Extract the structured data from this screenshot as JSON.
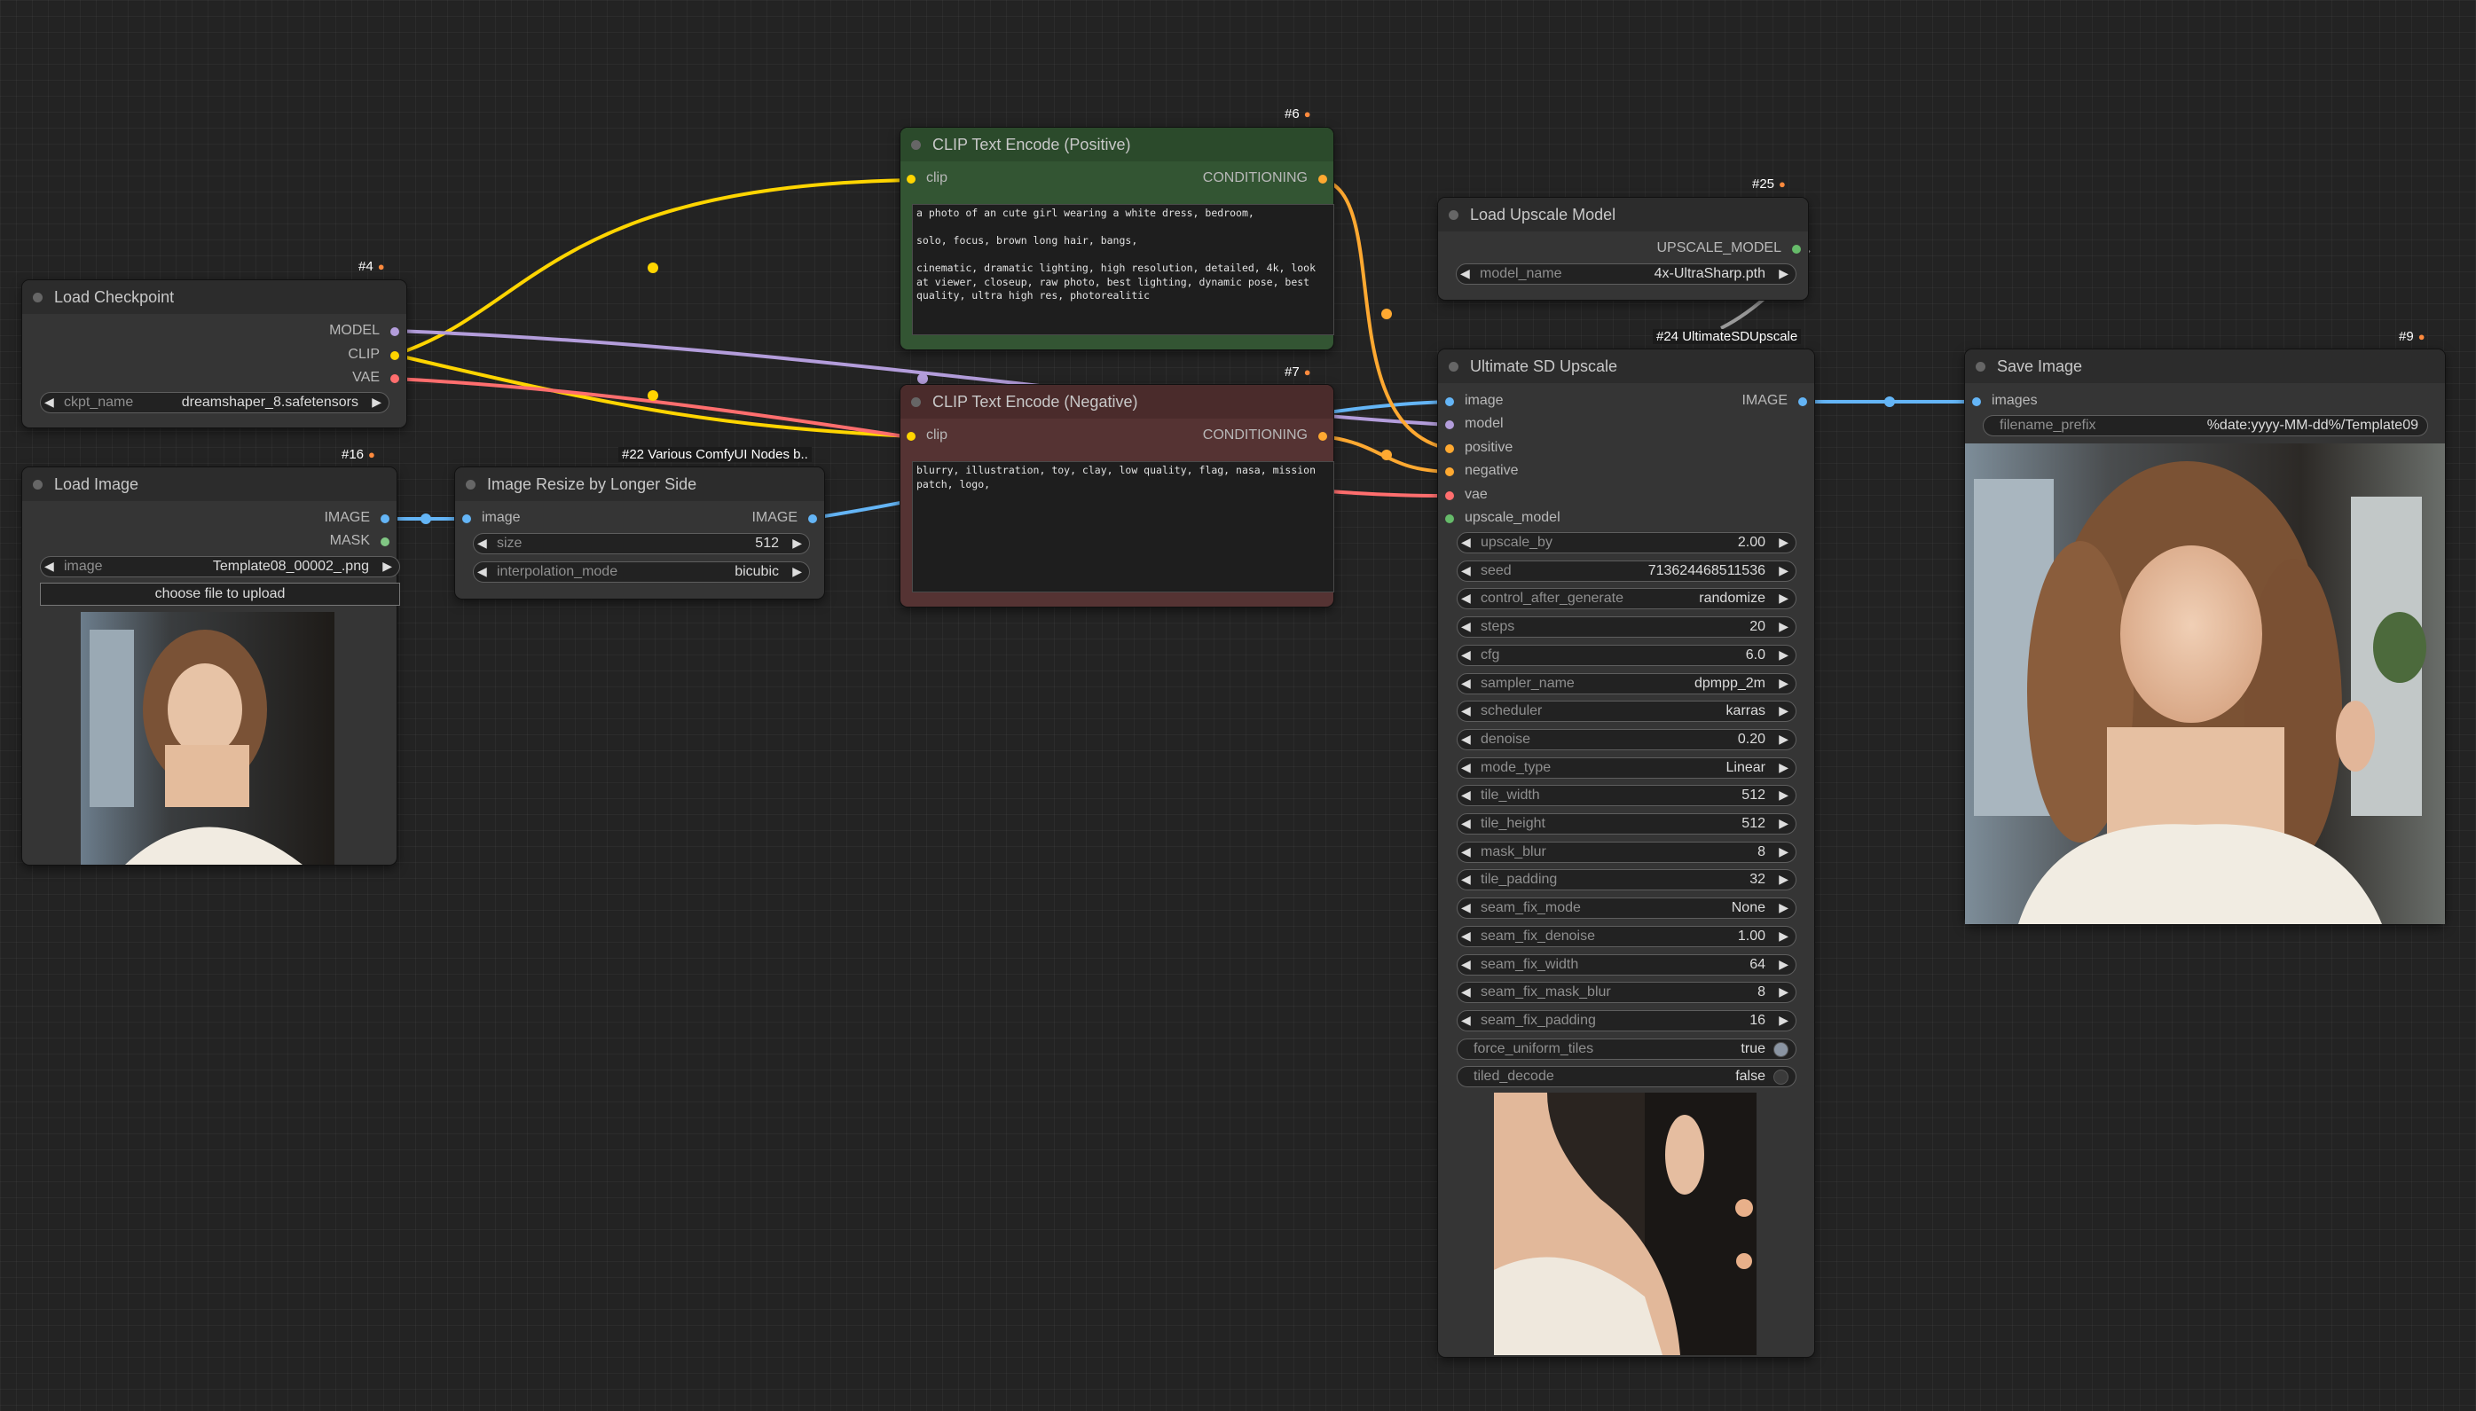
{
  "colors": {
    "clip": "#FFD500",
    "model": "#B39DDB",
    "vae": "#FF6E6E",
    "image": "#64B5F6",
    "mask": "#81C784",
    "conditioning": "#FFA931",
    "upscale_model": "#66BB6A"
  },
  "nodes": {
    "checkpoint": {
      "badge": "#4",
      "title": "Load Checkpoint",
      "outputs": {
        "model": "MODEL",
        "clip": "CLIP",
        "vae": "VAE"
      },
      "ckpt_name": {
        "key": "ckpt_name",
        "value": "dreamshaper_8.safetensors"
      }
    },
    "load_image": {
      "badge": "#16",
      "title": "Load Image",
      "outputs": {
        "image": "IMAGE",
        "mask": "MASK"
      },
      "image": {
        "key": "image",
        "value": "Template08_00002_.png"
      },
      "upload_button": "choose file to upload"
    },
    "resize": {
      "badge": "#22 Various ComfyUI Nodes b..",
      "title": "Image Resize by Longer Side",
      "input": "image",
      "output": "IMAGE",
      "size": {
        "key": "size",
        "value": "512"
      },
      "interpolation_mode": {
        "key": "interpolation_mode",
        "value": "bicubic"
      }
    },
    "positive": {
      "badge": "#6",
      "title": "CLIP Text Encode (Positive)",
      "input": "clip",
      "output": "CONDITIONING",
      "text": "a photo of an cute girl wearing a white dress, bedroom,\n\nsolo, focus, brown long hair, bangs,\n\ncinematic, dramatic lighting, high resolution, detailed, 4k, look at viewer, closeup, raw photo, best lighting, dynamic pose, best quality, ultra high res, photorealitic"
    },
    "negative": {
      "badge": "#7",
      "title": "CLIP Text Encode (Negative)",
      "input": "clip",
      "output": "CONDITIONING",
      "text": "blurry, illustration, toy, clay, low quality, flag, nasa, mission patch, logo,"
    },
    "upscale_loader": {
      "badge": "#25",
      "title": "Load Upscale Model",
      "output": "UPSCALE_MODEL",
      "model_name": {
        "key": "model_name",
        "value": "4x-UltraSharp.pth"
      }
    },
    "ultimate": {
      "badge": "#24 UltimateSDUpscale",
      "title": "Ultimate SD Upscale",
      "inputs": [
        "image",
        "model",
        "positive",
        "negative",
        "vae",
        "upscale_model"
      ],
      "output": "IMAGE",
      "widgets": [
        {
          "key": "upscale_by",
          "value": "2.00"
        },
        {
          "key": "seed",
          "value": "713624468511536"
        },
        {
          "key": "control_after_generate",
          "value": "randomize"
        },
        {
          "key": "steps",
          "value": "20"
        },
        {
          "key": "cfg",
          "value": "6.0"
        },
        {
          "key": "sampler_name",
          "value": "dpmpp_2m"
        },
        {
          "key": "scheduler",
          "value": "karras"
        },
        {
          "key": "denoise",
          "value": "0.20"
        },
        {
          "key": "mode_type",
          "value": "Linear"
        },
        {
          "key": "tile_width",
          "value": "512"
        },
        {
          "key": "tile_height",
          "value": "512"
        },
        {
          "key": "mask_blur",
          "value": "8"
        },
        {
          "key": "tile_padding",
          "value": "32"
        },
        {
          "key": "seam_fix_mode",
          "value": "None"
        },
        {
          "key": "seam_fix_denoise",
          "value": "1.00"
        },
        {
          "key": "seam_fix_width",
          "value": "64"
        },
        {
          "key": "seam_fix_mask_blur",
          "value": "8"
        },
        {
          "key": "seam_fix_padding",
          "value": "16"
        }
      ],
      "toggles": [
        {
          "key": "force_uniform_tiles",
          "value": "true"
        },
        {
          "key": "tiled_decode",
          "value": "false"
        }
      ]
    },
    "save": {
      "badge": "#9",
      "title": "Save Image",
      "input": "images",
      "filename_prefix": {
        "key": "filename_prefix",
        "value": "%date:yyyy-MM-dd%/Template09"
      }
    }
  },
  "icons": {
    "arrow_left": "◀",
    "arrow_right": "▶",
    "badge_icon": "fox-icon"
  }
}
